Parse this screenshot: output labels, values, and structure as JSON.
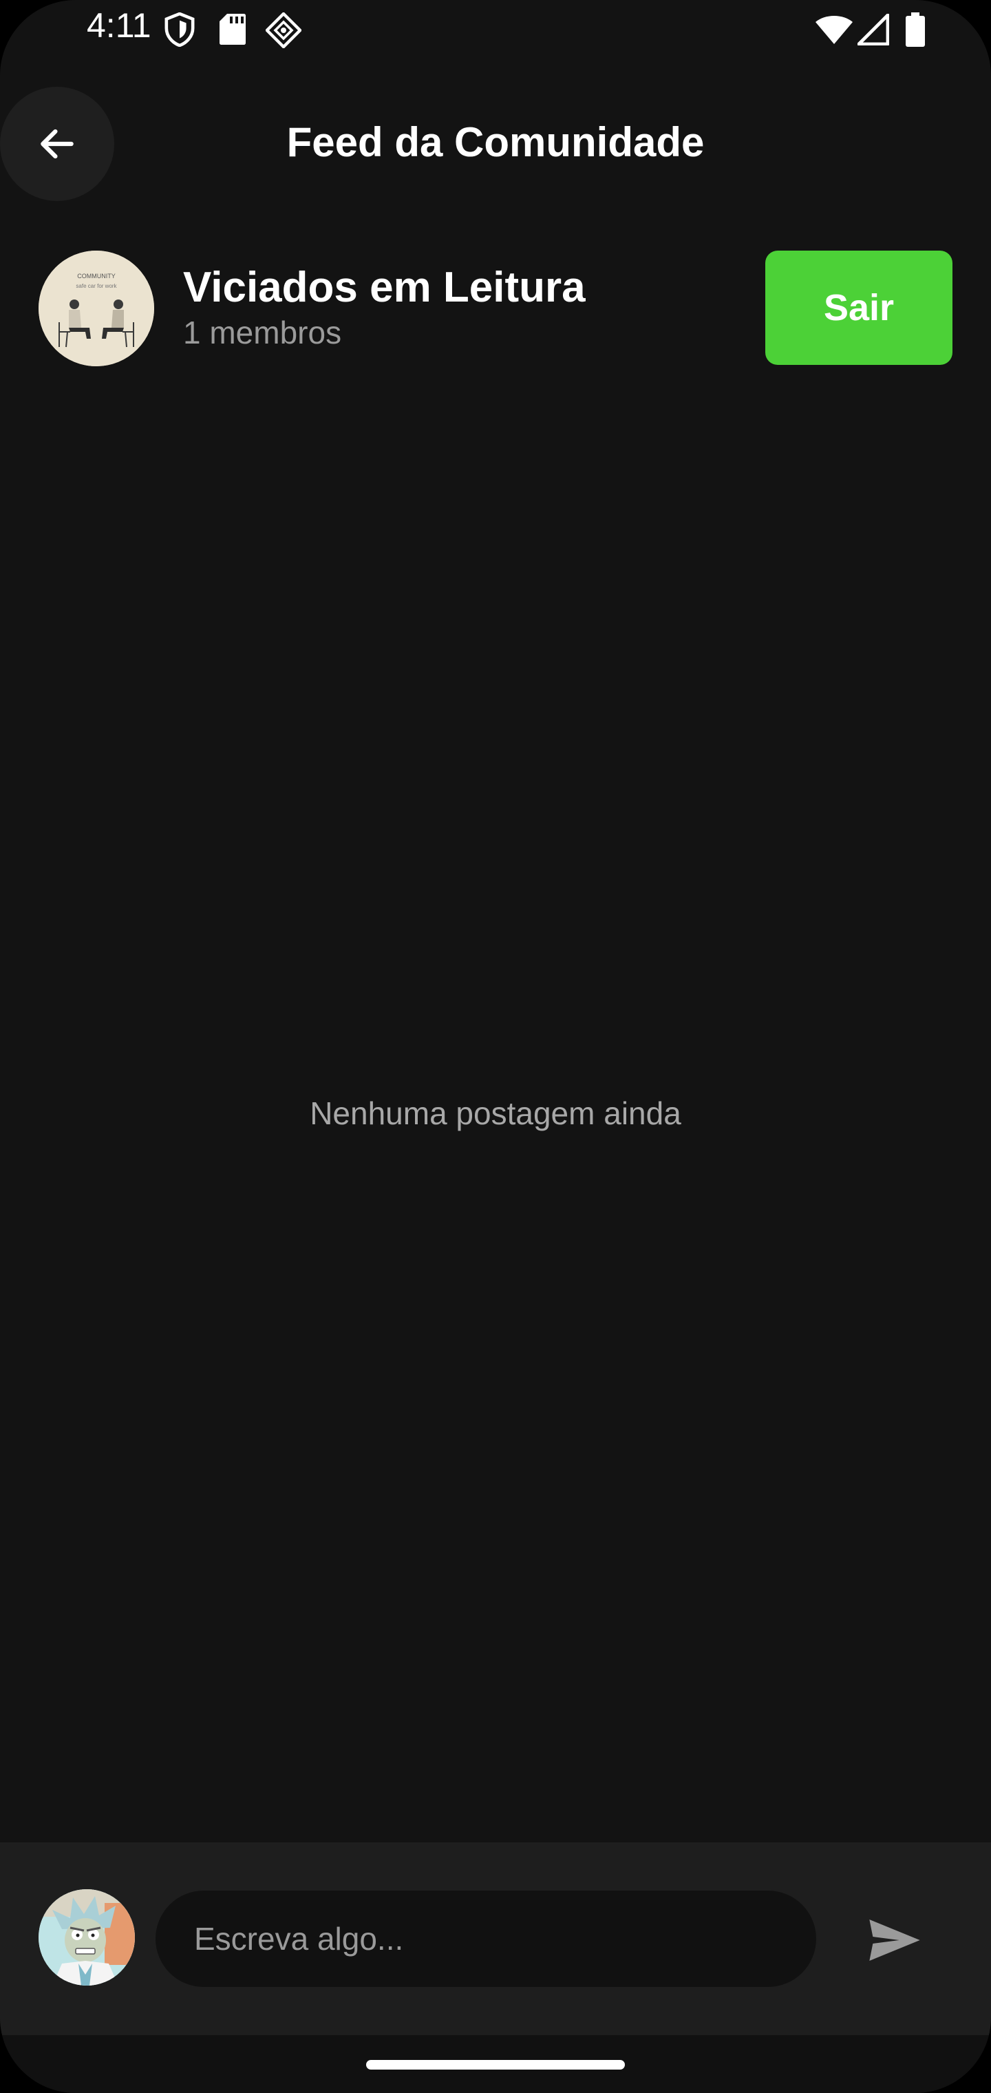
{
  "status_bar": {
    "time": "4:11",
    "left_icons": [
      "shield-icon",
      "sd-card-icon",
      "app-notification-icon"
    ],
    "right_icons": [
      "wifi-icon",
      "cell-signal-icon",
      "battery-icon"
    ]
  },
  "app_bar": {
    "back_icon": "arrow-left-icon",
    "title": "Feed da Comunidade"
  },
  "community": {
    "name": "Viciados em Leitura",
    "members": "1 membros",
    "avatar_text_line1": "COMMUNITY",
    "avatar_text_line2": "safe car for work",
    "leave_label": "Sair",
    "leave_color": "#4cd137"
  },
  "feed": {
    "empty_message": "Nenhuma postagem ainda"
  },
  "composer": {
    "input_value": "",
    "input_placeholder": "Escreva algo...",
    "send_icon": "send-icon"
  },
  "colors": {
    "background": "#131313",
    "composer_background": "#1e1e1e",
    "accent": "#4cd137"
  }
}
